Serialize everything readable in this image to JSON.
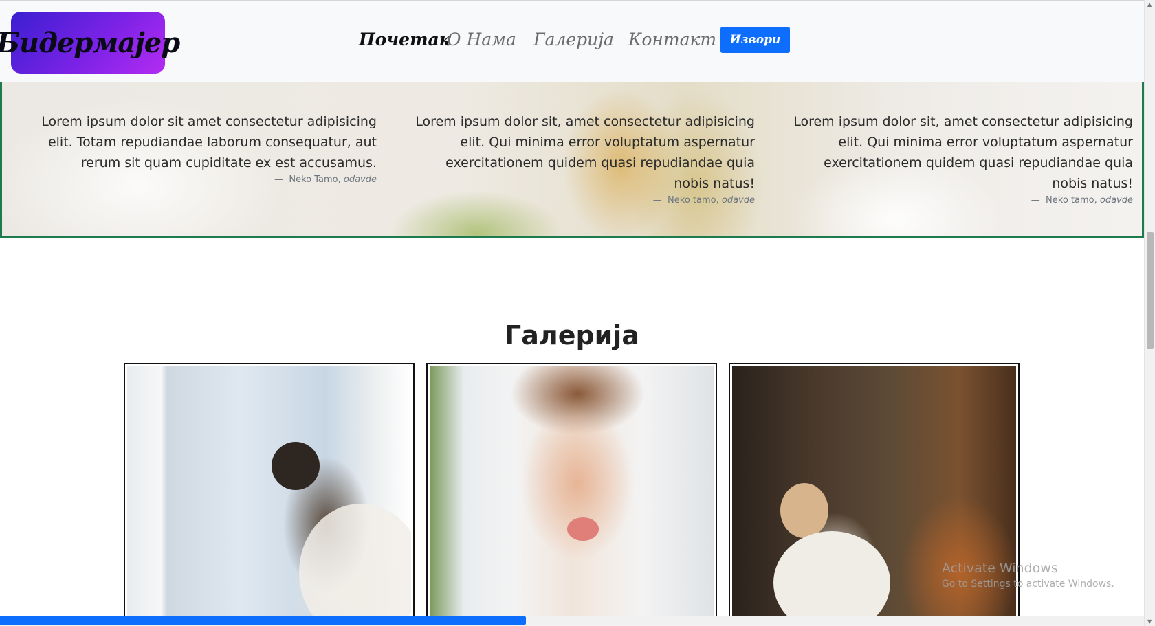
{
  "navbar": {
    "brand": "Бидермајер",
    "links": [
      {
        "label": "Почетак",
        "active": true
      },
      {
        "label": "О Нама",
        "active": false
      },
      {
        "label": "Галерија",
        "active": false
      },
      {
        "label": "Контакт",
        "active": false
      }
    ],
    "button_label": "Извори",
    "colors": {
      "brand_gradient": [
        "#3a1fd0",
        "#b42cf2"
      ],
      "button": "#0d6efd"
    }
  },
  "testimonials": [
    {
      "text": "Lorem ipsum dolor sit amet consectetur adipisicing elit. Totam repudiandae laborum consequatur, aut rerum sit quam cupiditate ex est accusamus.",
      "dash": "—",
      "author": "Neko Tamo,",
      "source": "odavde"
    },
    {
      "text": "Lorem ipsum dolor sit, amet consectetur adipisicing elit. Qui minima error voluptatum aspernatur exercitationem quidem quasi repudiandae quia nobis natus!",
      "dash": "—",
      "author": "Neko tamo,",
      "source": "odavde"
    },
    {
      "text": "Lorem ipsum dolor sit, amet consectetur adipisicing elit. Qui minima error voluptatum aspernatur exercitationem quidem quasi repudiandae quia nobis natus!",
      "dash": "—",
      "author": "Neko tamo,",
      "source": "odavde"
    }
  ],
  "gallery": {
    "title": "Галерија",
    "photos": [
      {
        "name": "couple-kiss-photo"
      },
      {
        "name": "bride-veil-photo"
      },
      {
        "name": "bride-chair-photo"
      }
    ]
  },
  "progress": {
    "fraction": 0.46,
    "color": "#0d6efd"
  },
  "watermark": {
    "line1": "Activate Windows",
    "line2": "Go to Settings to activate Windows."
  }
}
